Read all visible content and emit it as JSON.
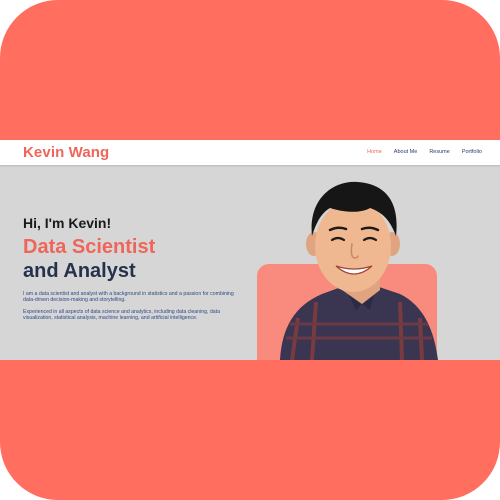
{
  "navbar": {
    "brand": "Kevin Wang",
    "links": [
      {
        "label": "Home",
        "active": true
      },
      {
        "label": "About Me",
        "active": false
      },
      {
        "label": "Resume",
        "active": false
      },
      {
        "label": "Portfolio",
        "active": false
      }
    ]
  },
  "hero": {
    "greeting": "Hi, I'm Kevin!",
    "role_line1": "Data Scientist",
    "role_line2": "and Analyst",
    "paragraph1": "I am a data scientist and analyst with a background in statistics and a passion for combining data-driven decision-making and storytelling.",
    "paragraph2": "Experienced in all aspects of data science and analytics, including data cleaning, data visualization, statistical analysis, machine learning, and artificial intelligence."
  },
  "colors": {
    "frame": "#ff6e5e",
    "accent": "#f0655a",
    "dark_navy": "#26324c",
    "card": "#f98a7e",
    "hero_bg": "#d6d6d6"
  },
  "icons": {
    "portrait": "profile-photo"
  }
}
